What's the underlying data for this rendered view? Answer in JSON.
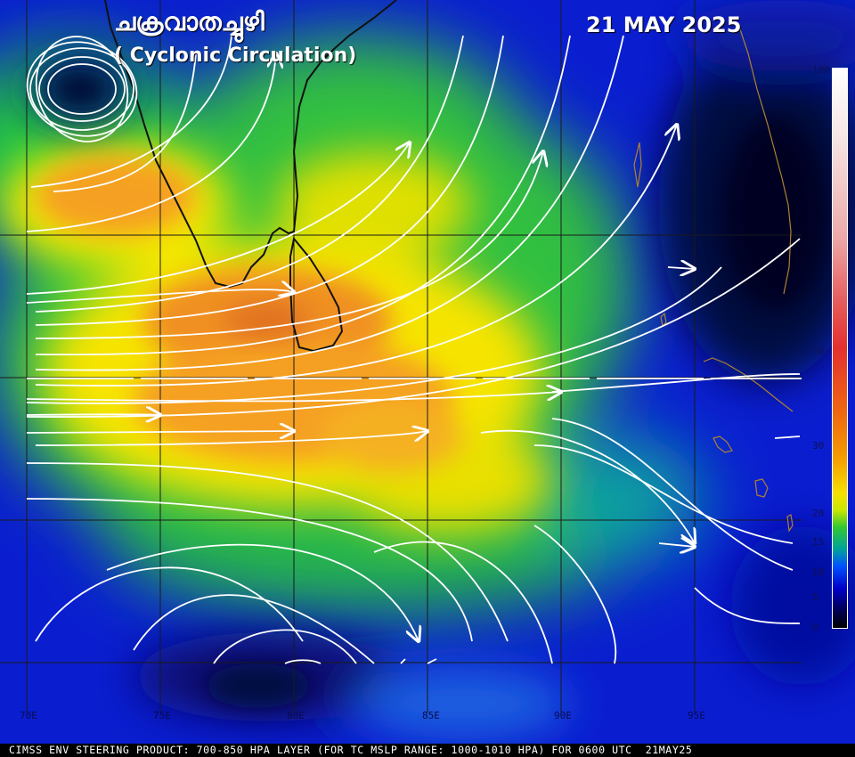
{
  "title_malayalam": "ചക്രവാതച്ചുഴി",
  "title_english": "( Cyclonic Circulation)",
  "date": "21 MAY 2025",
  "footer": "CIMSS ENV STEERING PRODUCT: 700-850 HPA LAYER (FOR TC MSLP RANGE: 1000-1010 HPA) FOR 0600 UTC  21MAY25",
  "longitude_labels": [
    "70E",
    "75E",
    "80E",
    "85E",
    "90E",
    "95E"
  ],
  "colorbar": {
    "labels": [
      "100",
      "50",
      "30",
      "20",
      "15",
      "10",
      "5",
      "0"
    ],
    "colors": [
      "#ffffff",
      "#e53030",
      "#f5a000",
      "#f6e000",
      "#32c832",
      "#0050ff",
      "#0000c8",
      "#000000"
    ]
  },
  "map_colors": {
    "coastline_land": "#1a1a1a",
    "coastline_east": "#b08030",
    "grid": "#1a1a1a",
    "streamline": "#ffffff"
  }
}
